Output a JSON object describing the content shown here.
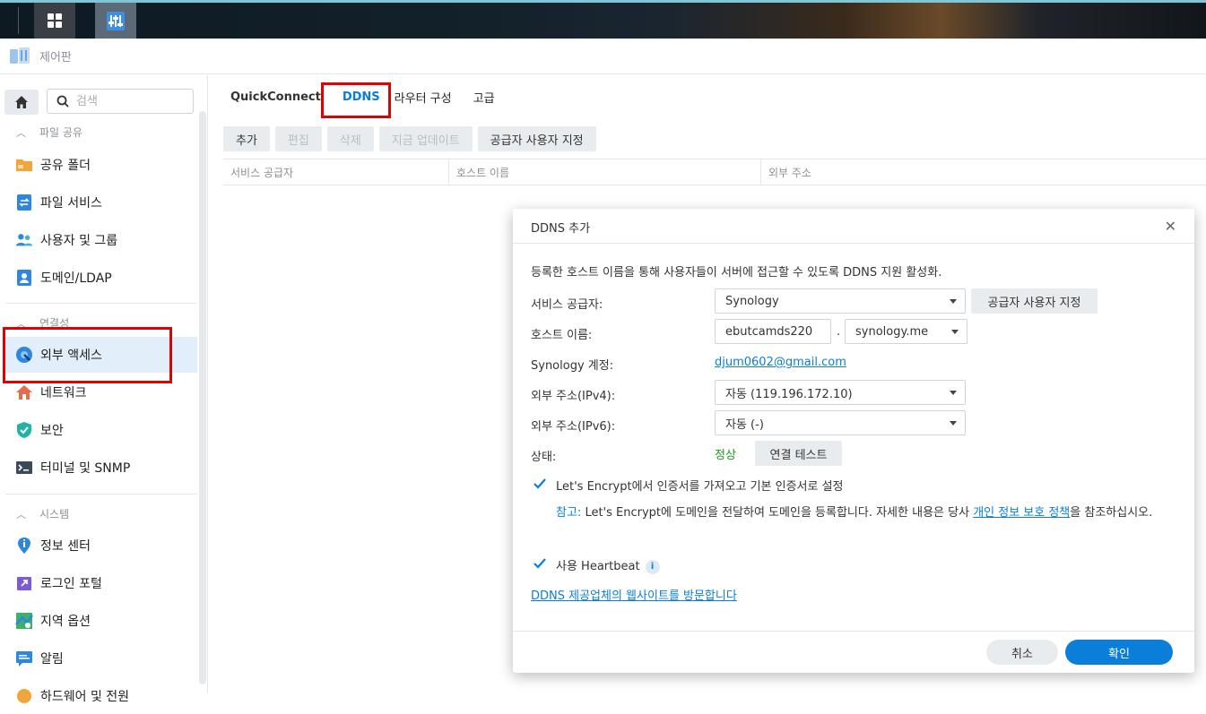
{
  "window": {
    "title": "제어판"
  },
  "search": {
    "placeholder": "검색"
  },
  "sidebar": {
    "sections": [
      {
        "label": "파일 공유"
      },
      {
        "label": "연결성"
      },
      {
        "label": "시스템"
      }
    ],
    "items": [
      {
        "label": "공유 폴더"
      },
      {
        "label": "파일 서비스"
      },
      {
        "label": "사용자 및 그룹"
      },
      {
        "label": "도메인/LDAP"
      },
      {
        "label": "외부 액세스"
      },
      {
        "label": "네트워크"
      },
      {
        "label": "보안"
      },
      {
        "label": "터미널 및 SNMP"
      },
      {
        "label": "정보 센터"
      },
      {
        "label": "로그인 포털"
      },
      {
        "label": "지역 옵션"
      },
      {
        "label": "알림"
      },
      {
        "label": "하드웨어 및 전원"
      }
    ]
  },
  "tabs": [
    {
      "label": "QuickConnect"
    },
    {
      "label": "DDNS"
    },
    {
      "label": "라우터 구성"
    },
    {
      "label": "고급"
    }
  ],
  "toolbar": {
    "add": "추가",
    "edit": "편집",
    "delete": "삭제",
    "update_now": "지금 업데이트",
    "custom_provider": "공급자 사용자 지정"
  },
  "grid": {
    "columns": [
      "서비스 공급자",
      "호스트 이름",
      "외부 주소"
    ]
  },
  "dialog": {
    "title": "DDNS 추가",
    "description": "등록한 호스트 이름을 통해 사용자들이 서버에 접근할 수 있도록 DDNS 지원 활성화.",
    "service_provider": {
      "label": "서비스 공급자:",
      "value": "Synology",
      "custom_button": "공급자 사용자 지정"
    },
    "hostname": {
      "label": "호스트 이름:",
      "value": "ebutcamds220",
      "dot": ".",
      "domain": "synology.me"
    },
    "account": {
      "label": "Synology 계정:",
      "value": "djum0602@gmail.com"
    },
    "ipv4": {
      "label": "외부 주소(IPv4):",
      "value": "자동 (119.196.172.10)"
    },
    "ipv6": {
      "label": "외부 주소(IPv6):",
      "value": "자동 (-)"
    },
    "status": {
      "label": "상태:",
      "value": "정상",
      "test_button": "연결 테스트"
    },
    "letsencrypt": {
      "label": "Let's Encrypt에서 인증서를 가져오고 기본 인증서로 설정",
      "checked": true
    },
    "note": {
      "prefix": "참고:",
      "text": " Let's Encrypt에 도메인을 전달하여 도메인을 등록합니다. 자세한 내용은 당사 ",
      "link": "개인 정보 보호 정책",
      "suffix": "을 참조하십시오."
    },
    "heartbeat": {
      "label": "사용 Heartbeat",
      "checked": true
    },
    "visit_link": "DDNS 제공업체의 웹사이트를 방문합니다",
    "cancel": "취소",
    "ok": "확인"
  },
  "colors": {
    "accent": "#0a7ed8",
    "highlight_box": "#e30000",
    "status_ok": "#1a9a1a"
  }
}
